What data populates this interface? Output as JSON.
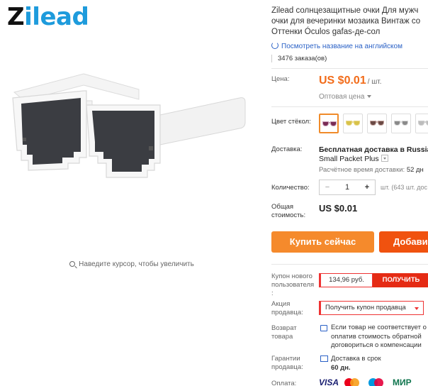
{
  "brand": {
    "logo_first": "Z",
    "logo_rest": "ilead"
  },
  "gallery": {
    "zoom_hint": "Наведите курсор, чтобы увеличить"
  },
  "product": {
    "title_lines": [
      "Zilead солнцезащитные очки Для мужч",
      "очки для вечеринки мозаика Винтаж со",
      "Оттенки Óculos gafas-де-сол"
    ],
    "translate_link": "Посмотреть название на английском",
    "orders": "3476 заказа(ов)"
  },
  "price": {
    "label": "Цена:",
    "value": "US $0.01",
    "unit": "/ шт.",
    "wholesale": "Оптовая цена"
  },
  "color": {
    "label": "Цвет стёкол:",
    "swatches": [
      {
        "frame": "#c9a0b8",
        "lens": "#7a2c55",
        "selected": true
      },
      {
        "frame": "#e9d98a",
        "lens": "#d8c24a",
        "selected": false
      },
      {
        "frame": "#c8a9a3",
        "lens": "#6b4a45",
        "selected": false
      },
      {
        "frame": "#d8d8d8",
        "lens": "#8a8a8a",
        "selected": false
      },
      {
        "frame": "#cfcfcf",
        "lens": "#bdbdbd",
        "selected": false
      }
    ],
    "accent": "#f08b2a"
  },
  "delivery": {
    "label": "Доставка:",
    "line1": "Бесплатная доставка в Russian",
    "line2": "Small Packet Plus",
    "eta_label": "Расчётное время доставки:",
    "eta_value": "52 дн"
  },
  "quantity": {
    "label": "Количество:",
    "minus": "−",
    "value": "1",
    "plus": "+",
    "available": "шт. (643 шт. дос"
  },
  "total": {
    "label_line1": "Общая",
    "label_line2": "стоимость:",
    "value": "US $0.01"
  },
  "actions": {
    "buy_now": "Купить сейчас",
    "add_to_cart": "Добави"
  },
  "coupon": {
    "label_line1": "Купон нового",
    "label_line2": "пользователя",
    "label_line3": ":",
    "amount": "134,96 руб.",
    "get": "ПОЛУЧИТЬ"
  },
  "seller_promo": {
    "label_line1": "Акция",
    "label_line2": "продавца:",
    "button": "Получить купон продавца"
  },
  "returns": {
    "label_line1": "Возврат",
    "label_line2": "товара",
    "text_line1": "Если товар не соответствует о",
    "text_line2": "оплатив стоимость обратной",
    "text_line3": "договориться о компенсации"
  },
  "guarantee": {
    "label_line1": "Гарантии",
    "label_line2": "продавца:",
    "text_line1": "Доставка в срок",
    "text_line2": "60 дн."
  },
  "payment": {
    "label": "Оплата:",
    "visa": "VISA",
    "mir": "МИР"
  },
  "colors": {
    "price": "#f26c1a",
    "buy_button": "#f58a2c",
    "cart_button": "#f0520f",
    "coupon_red": "#e52b14",
    "link_blue": "#2a61c6"
  }
}
